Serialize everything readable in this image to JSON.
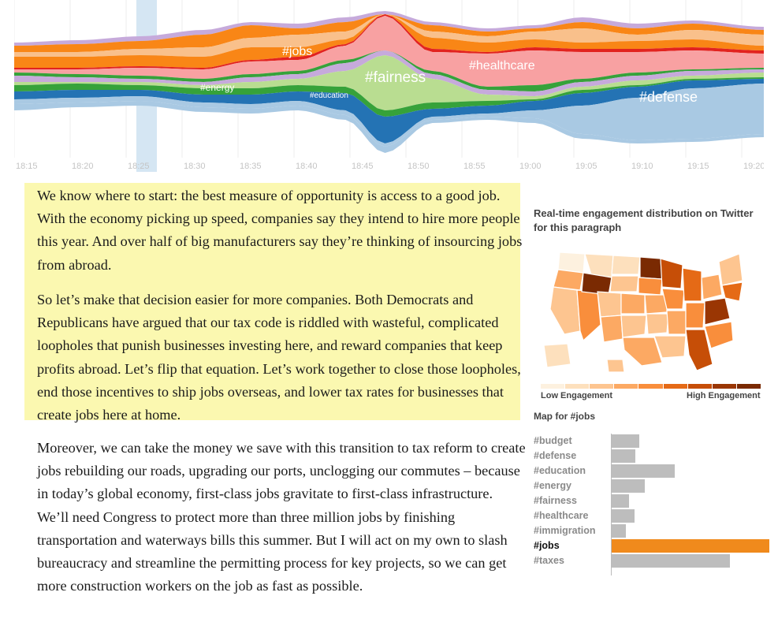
{
  "chart_data": [
    {
      "type": "area",
      "x_ticks": [
        "18:15",
        "18:20",
        "18:25",
        "18:30",
        "18:35",
        "18:40",
        "18:45",
        "18:50",
        "18:55",
        "19:00",
        "19:05",
        "19:10",
        "19:15",
        "19:20"
      ],
      "stream_labels": [
        {
          "text": "#jobs"
        },
        {
          "text": "#energy"
        },
        {
          "text": "#education"
        },
        {
          "text": "#fairness"
        },
        {
          "text": "#healthcare"
        },
        {
          "text": "#defense"
        }
      ],
      "colors": {
        "defense": "#2473b4",
        "immigration": "#a9c9e3",
        "education": "#b9dd91",
        "energy": "#36a23a",
        "fairness": "#f8a1a2",
        "healthcare": "#e2231f",
        "jobs": "#f9c08b",
        "taxes": "#f98616",
        "budget": "#c6aadb"
      }
    },
    {
      "type": "bar",
      "title": "Map for #jobs",
      "categories": [
        "#budget",
        "#defense",
        "#education",
        "#energy",
        "#fairness",
        "#healthcare",
        "#immigration",
        "#jobs",
        "#taxes"
      ],
      "values": [
        35,
        30,
        80,
        42,
        22,
        29,
        18,
        200,
        150
      ],
      "highlight": "#jobs",
      "highlight_color": "#f08a1c",
      "bar_color": "#bdbdbd"
    }
  ],
  "paragraphs": {
    "p1": "We know where to start: the best measure of opportunity is access to a good job. With the economy picking up speed, companies say they intend to hire more people this year. And over half of big manufacturers say they’re thinking of insourcing jobs from abroad.",
    "p2": "So let’s make that decision easier for more companies. Both Democrats and Republicans have argued that our tax code is riddled with wasteful, complicated loopholes that punish businesses investing here, and reward companies that keep profits abroad. Let’s flip that equation. Let’s work together to close those loopholes, end those incentives to ship jobs overseas, and lower tax rates for businesses that create jobs here at home.",
    "p3": "Moreover, we can take the money we save with this transition to tax reform to create jobs rebuilding our roads, upgrading our ports, unclogging our commutes – because in today’s global economy, first-class jobs gravitate to first-class infrastructure. We’ll need Congress to protect more than three million jobs by finishing transportation and waterways bills this summer. But I will act on my own to slash bureaucracy and streamline the permitting process for key projects, so we can get more construction workers on the job as fast as possible."
  },
  "engagement": {
    "title": "Real-time engagement distribution on Twitter for this paragraph",
    "low_label": "Low Engagement",
    "high_label": "High Engagement",
    "scale": [
      "#fdf1df",
      "#fde0bd",
      "#fdc590",
      "#fca963",
      "#f98e3c",
      "#e56a16",
      "#c64e07",
      "#9a3603",
      "#7a2a02"
    ]
  }
}
